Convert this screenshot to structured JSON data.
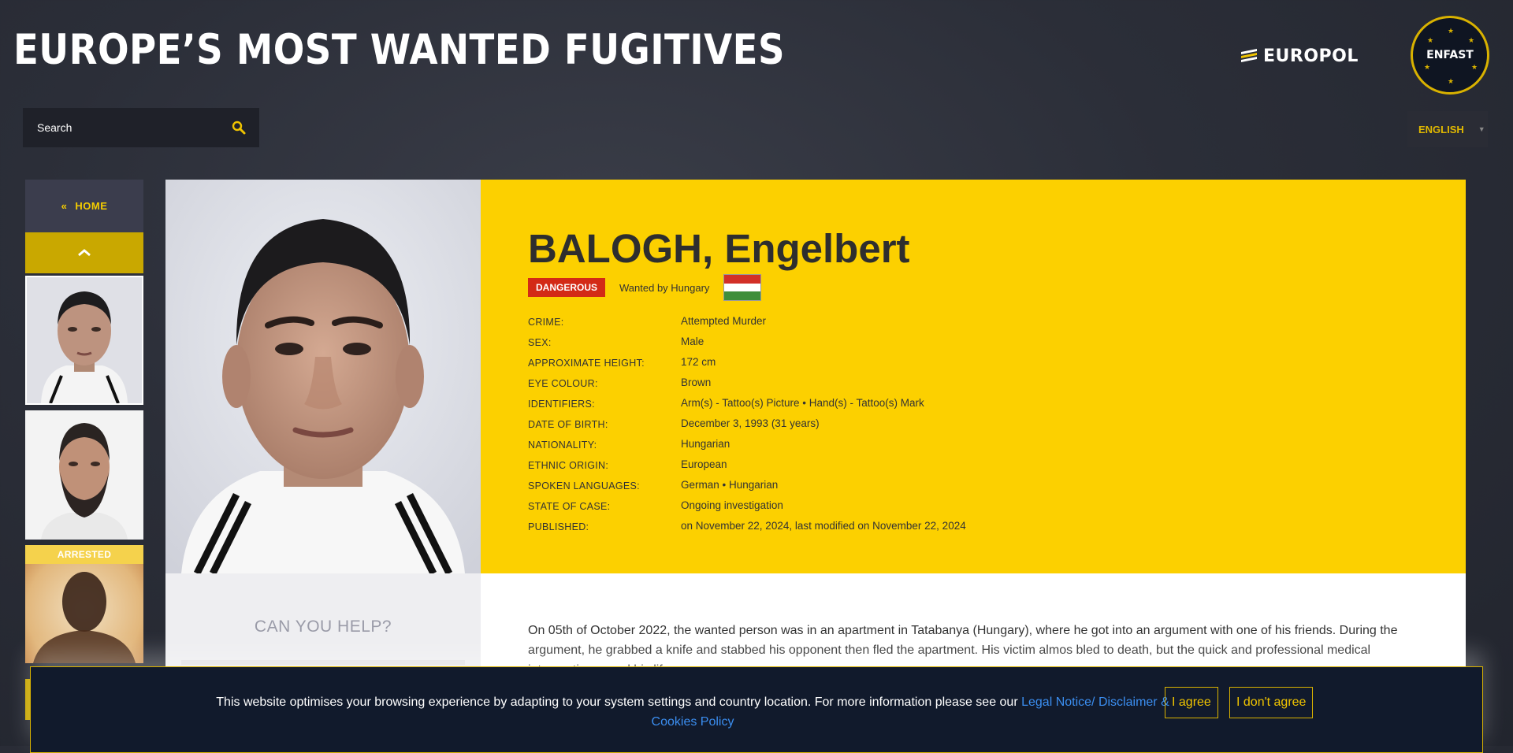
{
  "header": {
    "title": "EUROPE’S MOST WANTED FUGITIVES"
  },
  "logos": {
    "europol": "EUROPOL",
    "enfast": "ENFAST"
  },
  "search": {
    "placeholder": "Search"
  },
  "language": {
    "selected": "ENGLISH"
  },
  "sidebar": {
    "home_label": "HOME",
    "home_icon": "double-chevron-left-icon",
    "up_icon": "chevron-up-icon",
    "thumbnails": [
      {
        "status": ""
      },
      {
        "status": ""
      },
      {
        "status": "ARRESTED"
      }
    ]
  },
  "fugitive": {
    "name": "BALOGH, Engelbert",
    "badge": "DANGEROUS",
    "wanted_by": "Wanted by Hungary",
    "flag_colors": [
      "#d22f27",
      "#ffffff",
      "#3e8e3a"
    ],
    "details": [
      {
        "label": "Crime:",
        "value": "Attempted Murder"
      },
      {
        "label": "Sex:",
        "value": "Male"
      },
      {
        "label": "Approximate height:",
        "value": "172 cm"
      },
      {
        "label": "Eye colour:",
        "value": "Brown"
      },
      {
        "label": "Identifiers:",
        "value": "Arm(s) - Tattoo(s) Picture • Hand(s) - Tattoo(s) Mark"
      },
      {
        "label": "Date of birth:",
        "value": "December 3, 1993 (31 years)"
      },
      {
        "label": "Nationality:",
        "value": "Hungarian"
      },
      {
        "label": "Ethnic origin:",
        "value": "European"
      },
      {
        "label": "Spoken languages:",
        "value": "German • Hungarian"
      },
      {
        "label": "State of case:",
        "value": "Ongoing investigation"
      },
      {
        "label": "Published:",
        "value": "on November 22, 2024, last modified on November 22, 2024"
      }
    ],
    "description": "On 05th of October 2022, the wanted person was in an apartment in Tatabanya (Hungary), where he got into an argument with one of his friends. During the argument, he grabbed a knife and stabbed his opponent then fled the apartment. His victim almos bled to death, but the quick and professional medical intervention saved his life."
  },
  "help": {
    "title": "CAN YOU HELP?"
  },
  "cookie": {
    "text": "This website optimises your browsing experience by adapting to your system settings and country location. For more information please see our",
    "link": "Legal Notice/ Disclaimer & Cookies Policy",
    "agree": "I agree",
    "disagree": "I don't agree"
  },
  "colors": {
    "accent": "#fcd000",
    "danger": "#d32a16",
    "dark": "#111a2c"
  }
}
